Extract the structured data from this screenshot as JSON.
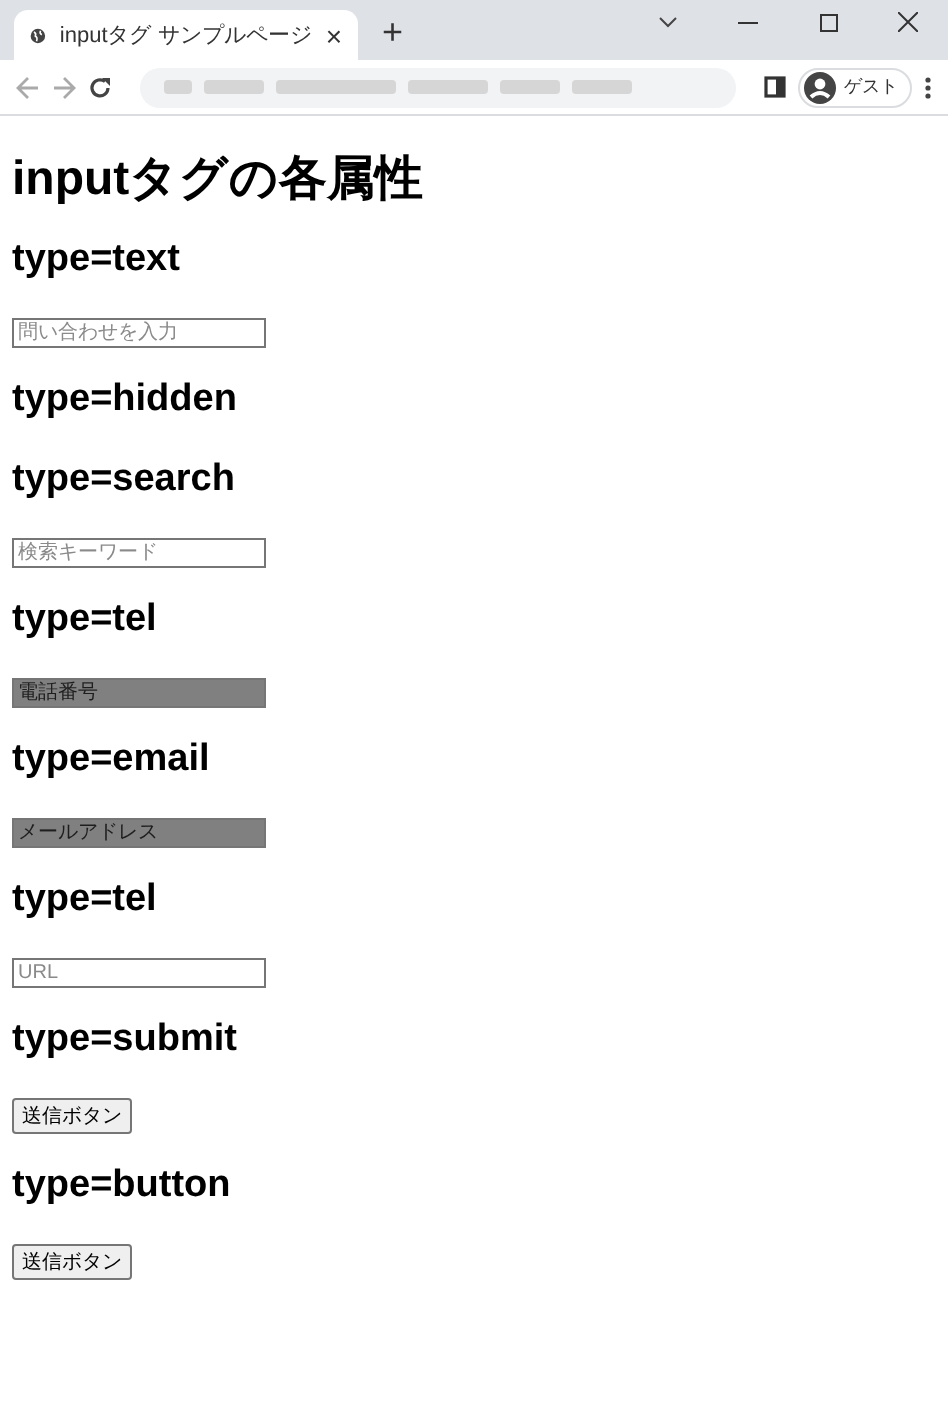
{
  "browser": {
    "tab_title": "inputタグ サンプルページ",
    "tab_close": "×",
    "new_tab": "+",
    "profile_label": "ゲスト"
  },
  "page": {
    "title": "inputタグの各属性",
    "sections": [
      {
        "heading": "type=text",
        "control": {
          "kind": "field",
          "placeholder": "問い合わせを入力",
          "shaded": false
        }
      },
      {
        "heading": "type=hidden"
      },
      {
        "heading": "type=search",
        "control": {
          "kind": "field",
          "placeholder": "検索キーワード",
          "shaded": false
        }
      },
      {
        "heading": "type=tel",
        "control": {
          "kind": "field",
          "placeholder": "電話番号",
          "shaded": true
        }
      },
      {
        "heading": "type=email",
        "control": {
          "kind": "field",
          "placeholder": "メールアドレス",
          "shaded": true
        }
      },
      {
        "heading": "type=tel",
        "control": {
          "kind": "field",
          "placeholder": "URL",
          "shaded": false
        }
      },
      {
        "heading": "type=submit",
        "control": {
          "kind": "button",
          "label": "送信ボタン"
        }
      },
      {
        "heading": "type=button",
        "control": {
          "kind": "button",
          "label": "送信ボタン"
        }
      }
    ]
  }
}
